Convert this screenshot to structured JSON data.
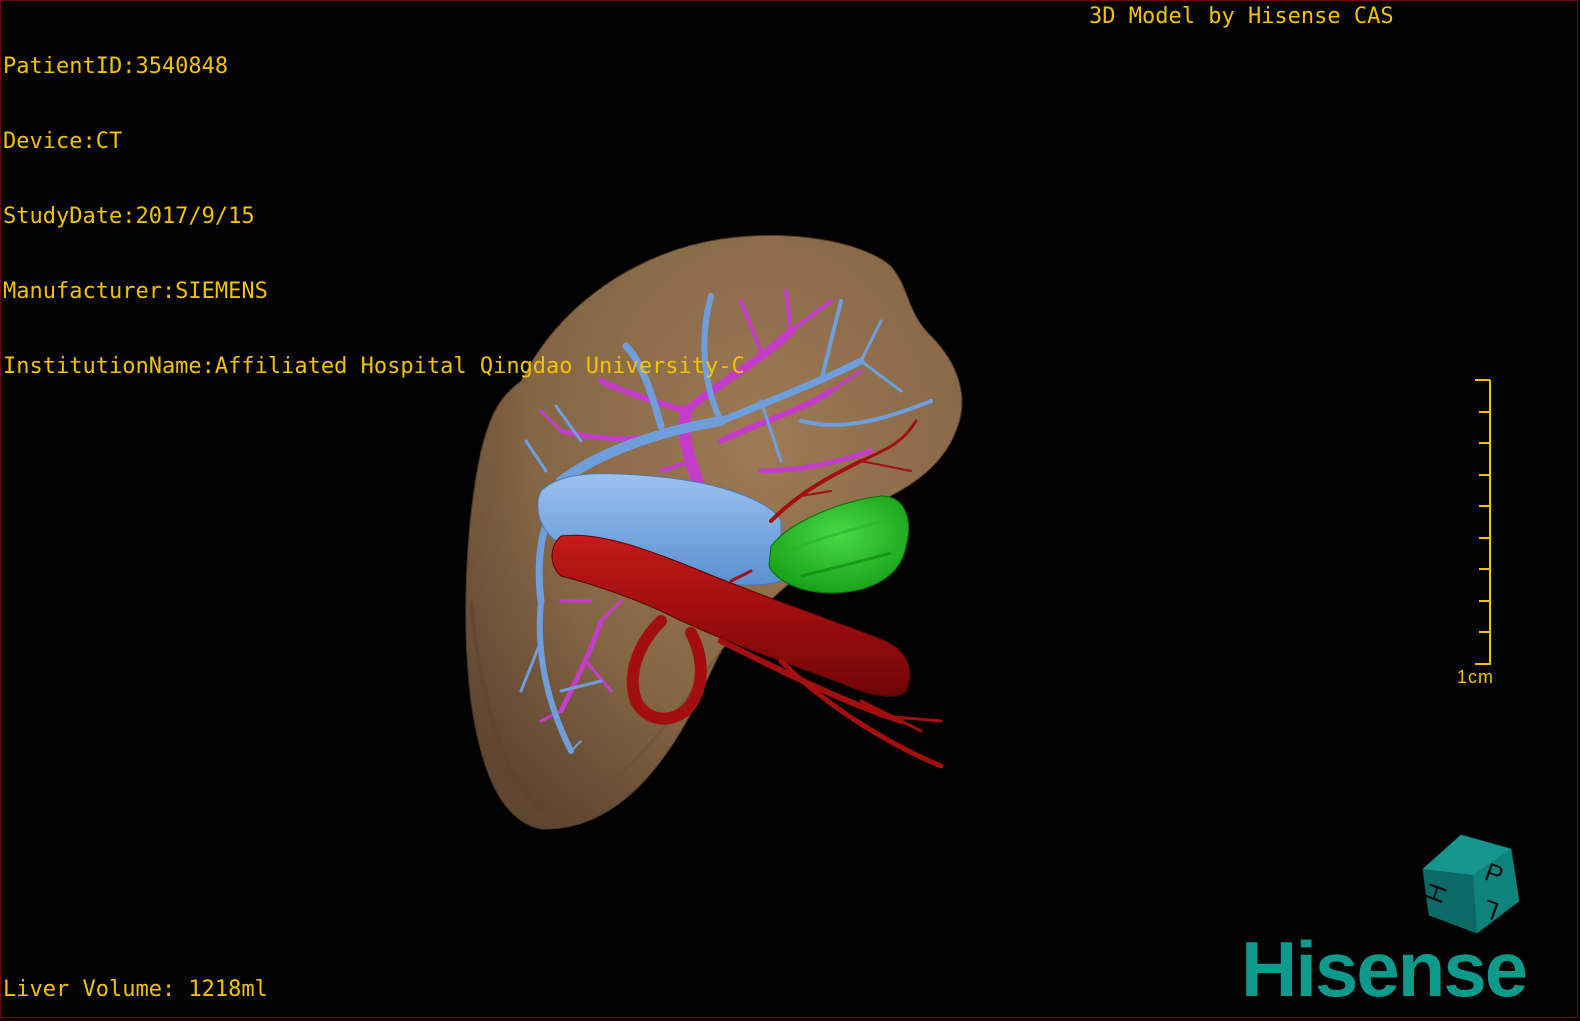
{
  "overlay": {
    "patient_id": "PatientID:3540848",
    "device": "Device:CT",
    "study_date": "StudyDate:2017/9/15",
    "manufacturer": "Manufacturer:SIEMENS",
    "institution": "InstitutionName:Affiliated Hospital Qingdao University-C",
    "caption": "3D Model by Hisense CAS",
    "liver_volume": "Liver Volume: 1218ml"
  },
  "scale": {
    "label": "1cm"
  },
  "orientation_cube": {
    "letters": [
      "P",
      "H",
      "L"
    ]
  },
  "logo": {
    "text": "Hisense"
  },
  "colors": {
    "overlay_text": "#f2c200",
    "liver": "#8c6d4b",
    "hepatic_vein": "#6e9fdc",
    "portal_vein": "#c53ccb",
    "artery": "#a30f0f",
    "tumor": "#1fb51f",
    "logo": "#0c9a8d"
  }
}
